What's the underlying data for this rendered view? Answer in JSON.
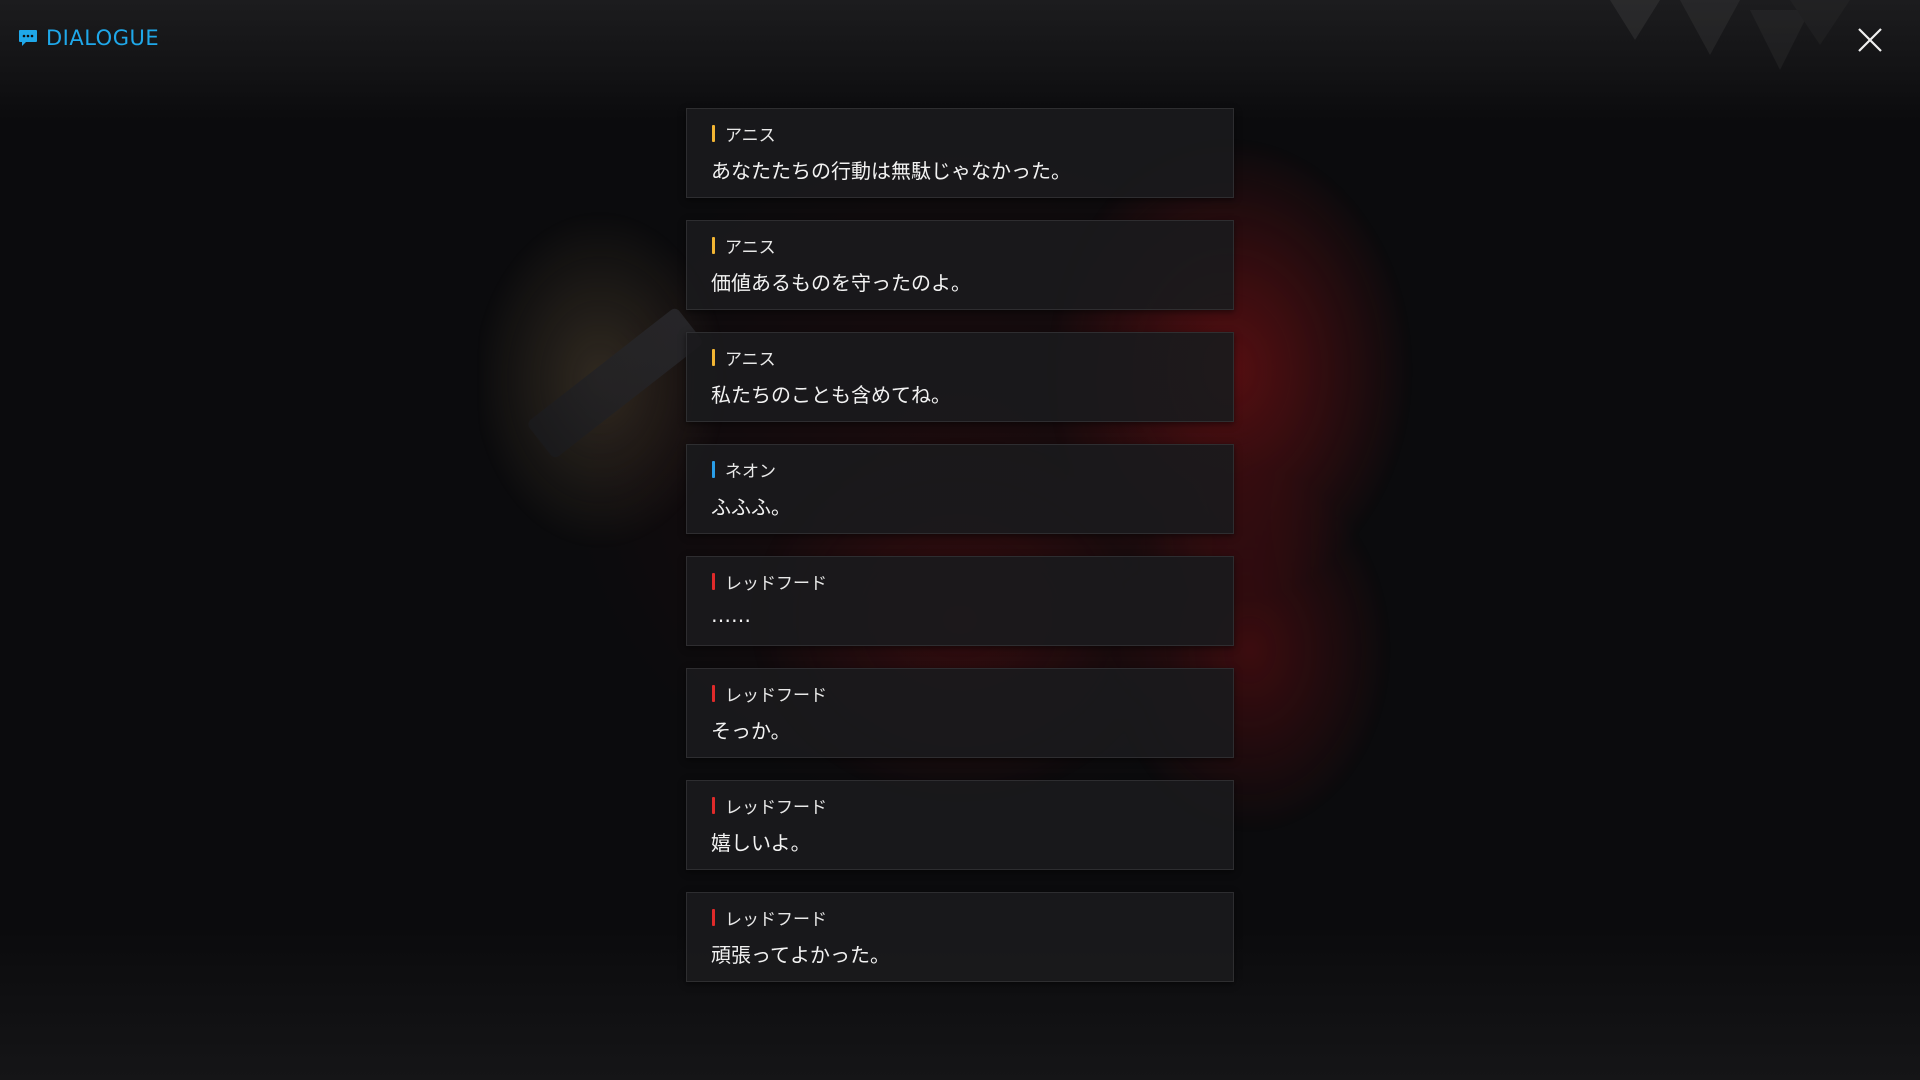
{
  "header": {
    "title": "DIALOGUE",
    "title_icon": "chat-bubble-icon",
    "close_icon": "close-icon",
    "accent_color": "#1fa8ea"
  },
  "speaker_colors": {
    "アニス": "#f2b533",
    "ネオン": "#2a9ee8",
    "レッドフード": "#e02a2a"
  },
  "dialogue": [
    {
      "speaker": "アニス",
      "text": "あなたたちの行動は無駄じゃなかった。",
      "color": "#f2b533"
    },
    {
      "speaker": "アニス",
      "text": "価値あるものを守ったのよ。",
      "color": "#f2b533"
    },
    {
      "speaker": "アニス",
      "text": "私たちのことも含めてね。",
      "color": "#f2b533"
    },
    {
      "speaker": "ネオン",
      "text": "ふふふ。",
      "color": "#2a9ee8"
    },
    {
      "speaker": "レッドフード",
      "text": "……",
      "color": "#e02a2a"
    },
    {
      "speaker": "レッドフード",
      "text": "そっか。",
      "color": "#e02a2a"
    },
    {
      "speaker": "レッドフード",
      "text": "嬉しいよ。",
      "color": "#e02a2a"
    },
    {
      "speaker": "レッドフード",
      "text": "頑張ってよかった。",
      "color": "#e02a2a"
    }
  ]
}
